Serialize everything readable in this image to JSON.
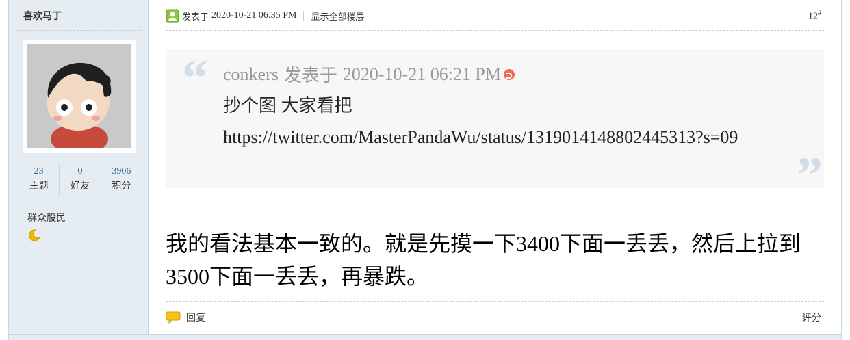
{
  "author": {
    "name": "喜欢马丁",
    "stats": [
      {
        "value": "23",
        "label": "主题"
      },
      {
        "value": "0",
        "label": "好友"
      },
      {
        "value": "3906",
        "label": "积分"
      }
    ],
    "group": "群众股民"
  },
  "post": {
    "posted_prefix": "发表于",
    "date": "2020-10-21 06:35 PM",
    "show_all_floors": "显示全部楼层",
    "floor_number": "12",
    "floor_mark": "#"
  },
  "quote": {
    "author": "conkers",
    "posted_prefix": "发表于",
    "date": "2020-10-21 06:21 PM",
    "line1": "抄个图 大家看把",
    "line2": "https://twitter.com/MasterPandaWu/status/1319014148802445313?s=09"
  },
  "reply": {
    "line1": "我的看法基本一致的。就是先摸一下3400下面一丢丢，然后上拉到",
    "line2": "3500下面一丢丢，再暴跌。"
  },
  "footer": {
    "reply_label": "回复",
    "rate_label": "评分"
  },
  "colors": {
    "sidebar_bg": "#e5edf2",
    "border": "#c2d5e3",
    "quote_bg": "#f7f7f7",
    "link": "#336699"
  }
}
